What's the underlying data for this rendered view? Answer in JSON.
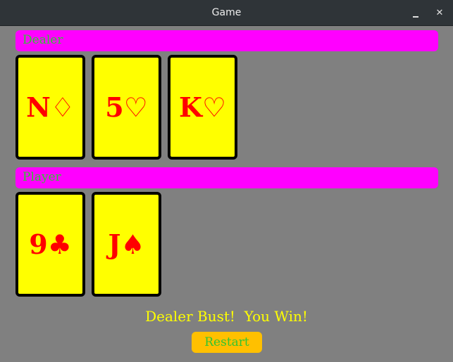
{
  "window": {
    "title": "Game",
    "minimize_label": "_",
    "close_label": "✕"
  },
  "dealer": {
    "label": "Dealer",
    "cards": [
      {
        "rank": "N",
        "suit": "♢"
      },
      {
        "rank": "5",
        "suit": "♡"
      },
      {
        "rank": "K",
        "suit": "♡"
      }
    ]
  },
  "player": {
    "label": "Player",
    "cards": [
      {
        "rank": "9",
        "suit": "♣"
      },
      {
        "rank": "J",
        "suit": "♠"
      }
    ]
  },
  "status": {
    "message": "Dealer Bust!  You Win!"
  },
  "controls": {
    "restart_label": "Restart"
  },
  "colors": {
    "background": "#808080",
    "section_bar": "#ff00ff",
    "section_text": "#32c432",
    "card_fill": "#ffff00",
    "card_border": "#000000",
    "card_text": "#ff0000",
    "status_text": "#ffff00",
    "button_fill": "#ffc000",
    "button_text": "#32c432"
  }
}
